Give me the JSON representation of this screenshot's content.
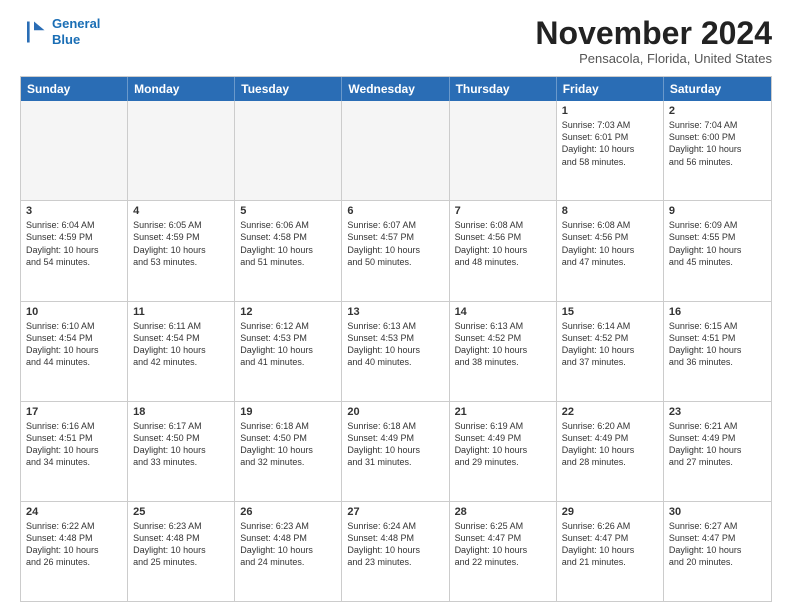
{
  "logo": {
    "line1": "General",
    "line2": "Blue"
  },
  "title": "November 2024",
  "subtitle": "Pensacola, Florida, United States",
  "header_days": [
    "Sunday",
    "Monday",
    "Tuesday",
    "Wednesday",
    "Thursday",
    "Friday",
    "Saturday"
  ],
  "weeks": [
    [
      {
        "day": "",
        "info": "",
        "empty": true
      },
      {
        "day": "",
        "info": "",
        "empty": true
      },
      {
        "day": "",
        "info": "",
        "empty": true
      },
      {
        "day": "",
        "info": "",
        "empty": true
      },
      {
        "day": "",
        "info": "",
        "empty": true
      },
      {
        "day": "1",
        "info": "Sunrise: 7:03 AM\nSunset: 6:01 PM\nDaylight: 10 hours\nand 58 minutes.",
        "empty": false
      },
      {
        "day": "2",
        "info": "Sunrise: 7:04 AM\nSunset: 6:00 PM\nDaylight: 10 hours\nand 56 minutes.",
        "empty": false
      }
    ],
    [
      {
        "day": "3",
        "info": "Sunrise: 6:04 AM\nSunset: 4:59 PM\nDaylight: 10 hours\nand 54 minutes.",
        "empty": false
      },
      {
        "day": "4",
        "info": "Sunrise: 6:05 AM\nSunset: 4:59 PM\nDaylight: 10 hours\nand 53 minutes.",
        "empty": false
      },
      {
        "day": "5",
        "info": "Sunrise: 6:06 AM\nSunset: 4:58 PM\nDaylight: 10 hours\nand 51 minutes.",
        "empty": false
      },
      {
        "day": "6",
        "info": "Sunrise: 6:07 AM\nSunset: 4:57 PM\nDaylight: 10 hours\nand 50 minutes.",
        "empty": false
      },
      {
        "day": "7",
        "info": "Sunrise: 6:08 AM\nSunset: 4:56 PM\nDaylight: 10 hours\nand 48 minutes.",
        "empty": false
      },
      {
        "day": "8",
        "info": "Sunrise: 6:08 AM\nSunset: 4:56 PM\nDaylight: 10 hours\nand 47 minutes.",
        "empty": false
      },
      {
        "day": "9",
        "info": "Sunrise: 6:09 AM\nSunset: 4:55 PM\nDaylight: 10 hours\nand 45 minutes.",
        "empty": false
      }
    ],
    [
      {
        "day": "10",
        "info": "Sunrise: 6:10 AM\nSunset: 4:54 PM\nDaylight: 10 hours\nand 44 minutes.",
        "empty": false
      },
      {
        "day": "11",
        "info": "Sunrise: 6:11 AM\nSunset: 4:54 PM\nDaylight: 10 hours\nand 42 minutes.",
        "empty": false
      },
      {
        "day": "12",
        "info": "Sunrise: 6:12 AM\nSunset: 4:53 PM\nDaylight: 10 hours\nand 41 minutes.",
        "empty": false
      },
      {
        "day": "13",
        "info": "Sunrise: 6:13 AM\nSunset: 4:53 PM\nDaylight: 10 hours\nand 40 minutes.",
        "empty": false
      },
      {
        "day": "14",
        "info": "Sunrise: 6:13 AM\nSunset: 4:52 PM\nDaylight: 10 hours\nand 38 minutes.",
        "empty": false
      },
      {
        "day": "15",
        "info": "Sunrise: 6:14 AM\nSunset: 4:52 PM\nDaylight: 10 hours\nand 37 minutes.",
        "empty": false
      },
      {
        "day": "16",
        "info": "Sunrise: 6:15 AM\nSunset: 4:51 PM\nDaylight: 10 hours\nand 36 minutes.",
        "empty": false
      }
    ],
    [
      {
        "day": "17",
        "info": "Sunrise: 6:16 AM\nSunset: 4:51 PM\nDaylight: 10 hours\nand 34 minutes.",
        "empty": false
      },
      {
        "day": "18",
        "info": "Sunrise: 6:17 AM\nSunset: 4:50 PM\nDaylight: 10 hours\nand 33 minutes.",
        "empty": false
      },
      {
        "day": "19",
        "info": "Sunrise: 6:18 AM\nSunset: 4:50 PM\nDaylight: 10 hours\nand 32 minutes.",
        "empty": false
      },
      {
        "day": "20",
        "info": "Sunrise: 6:18 AM\nSunset: 4:49 PM\nDaylight: 10 hours\nand 31 minutes.",
        "empty": false
      },
      {
        "day": "21",
        "info": "Sunrise: 6:19 AM\nSunset: 4:49 PM\nDaylight: 10 hours\nand 29 minutes.",
        "empty": false
      },
      {
        "day": "22",
        "info": "Sunrise: 6:20 AM\nSunset: 4:49 PM\nDaylight: 10 hours\nand 28 minutes.",
        "empty": false
      },
      {
        "day": "23",
        "info": "Sunrise: 6:21 AM\nSunset: 4:49 PM\nDaylight: 10 hours\nand 27 minutes.",
        "empty": false
      }
    ],
    [
      {
        "day": "24",
        "info": "Sunrise: 6:22 AM\nSunset: 4:48 PM\nDaylight: 10 hours\nand 26 minutes.",
        "empty": false
      },
      {
        "day": "25",
        "info": "Sunrise: 6:23 AM\nSunset: 4:48 PM\nDaylight: 10 hours\nand 25 minutes.",
        "empty": false
      },
      {
        "day": "26",
        "info": "Sunrise: 6:23 AM\nSunset: 4:48 PM\nDaylight: 10 hours\nand 24 minutes.",
        "empty": false
      },
      {
        "day": "27",
        "info": "Sunrise: 6:24 AM\nSunset: 4:48 PM\nDaylight: 10 hours\nand 23 minutes.",
        "empty": false
      },
      {
        "day": "28",
        "info": "Sunrise: 6:25 AM\nSunset: 4:47 PM\nDaylight: 10 hours\nand 22 minutes.",
        "empty": false
      },
      {
        "day": "29",
        "info": "Sunrise: 6:26 AM\nSunset: 4:47 PM\nDaylight: 10 hours\nand 21 minutes.",
        "empty": false
      },
      {
        "day": "30",
        "info": "Sunrise: 6:27 AM\nSunset: 4:47 PM\nDaylight: 10 hours\nand 20 minutes.",
        "empty": false
      }
    ]
  ]
}
